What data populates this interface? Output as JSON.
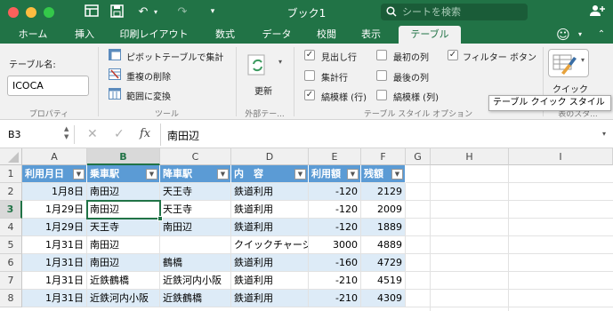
{
  "title_bar": {
    "title": "ブック1",
    "search_placeholder": "シートを検索"
  },
  "tabs": [
    "ホーム",
    "挿入",
    "印刷レイアウト",
    "数式",
    "データ",
    "校閲",
    "表示",
    "テーブル"
  ],
  "active_tab": "テーブル",
  "ribbon": {
    "properties": {
      "name_label": "テーブル名:",
      "name_value": "ICOCA",
      "group_label": "プロパティ"
    },
    "tools": {
      "pivot": "ピボットテーブルで集計",
      "remove_dupes": "重複の削除",
      "convert_range": "範囲に変換",
      "group_label": "ツール"
    },
    "external": {
      "refresh": "更新",
      "group_label": "外部テー..."
    },
    "style_options": {
      "header_row": "見出し行",
      "total_row": "集計行",
      "banded_rows": "縞模様 (行)",
      "first_column": "最初の列",
      "last_column": "最後の列",
      "banded_columns": "縞模様 (列)",
      "filter_button": "フィルター ボタン",
      "group_label": "テーブル スタイル オプション"
    },
    "checked": {
      "header_row": true,
      "total_row": false,
      "banded_rows": true,
      "first_column": false,
      "last_column": false,
      "banded_columns": false,
      "filter_button": true
    },
    "styles": {
      "quick_label": "クイック",
      "group_label": "表のスタ..."
    }
  },
  "tooltip": "テーブル クイック スタイル",
  "formula_bar": {
    "name_box": "B3",
    "fx": "fx",
    "content": "南田辺"
  },
  "columns": [
    "A",
    "B",
    "C",
    "D",
    "E",
    "F",
    "G",
    "H",
    "I"
  ],
  "rows": [
    "1",
    "2",
    "3",
    "4",
    "5",
    "6",
    "7",
    "8"
  ],
  "selected": {
    "column": "B",
    "row": "3"
  },
  "table": {
    "headers": [
      "利用月日",
      "乗車駅",
      "降車駅",
      "内　容",
      "利用額",
      "残額"
    ],
    "rows": [
      [
        "1月8日",
        "南田辺",
        "天王寺",
        "鉄道利用",
        "-120",
        "2129"
      ],
      [
        "1月29日",
        "南田辺",
        "天王寺",
        "鉄道利用",
        "-120",
        "2009"
      ],
      [
        "1月29日",
        "天王寺",
        "南田辺",
        "鉄道利用",
        "-120",
        "1889"
      ],
      [
        "1月31日",
        "南田辺",
        "",
        "クイックチャージ",
        "3000",
        "4889"
      ],
      [
        "1月31日",
        "南田辺",
        "鶴橋",
        "鉄道利用",
        "-160",
        "4729"
      ],
      [
        "1月31日",
        "近鉄鶴橋",
        "近鉄河内小阪",
        "鉄道利用",
        "-210",
        "4519"
      ],
      [
        "1月31日",
        "近鉄河内小阪",
        "近鉄鶴橋",
        "鉄道利用",
        "-210",
        "4309"
      ]
    ]
  },
  "colors": {
    "excel_green": "#217346",
    "table_header": "#5b9bd5",
    "band": "#ddebf7"
  }
}
